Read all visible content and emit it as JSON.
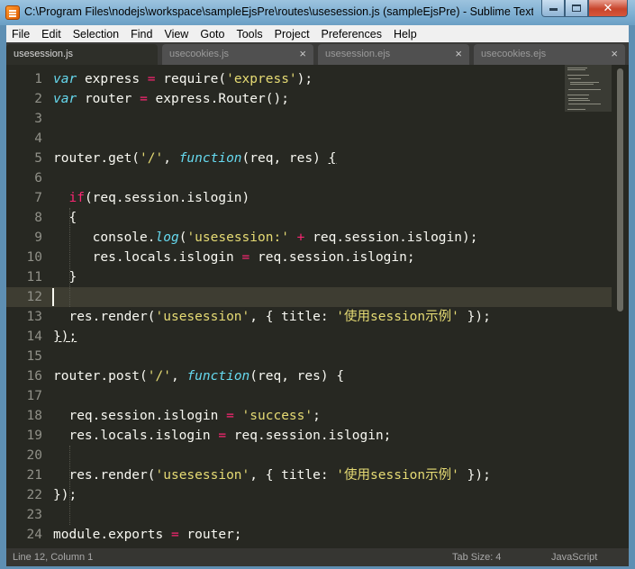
{
  "window": {
    "title": "C:\\Program Files\\nodejs\\workspace\\sampleEjsPre\\routes\\usesession.js (sampleEjsPre) - Sublime Text",
    "icon": "sublime-text-icon"
  },
  "menu": [
    "File",
    "Edit",
    "Selection",
    "Find",
    "View",
    "Goto",
    "Tools",
    "Project",
    "Preferences",
    "Help"
  ],
  "tabs": [
    {
      "label": "usesession.js",
      "active": true
    },
    {
      "label": "usecookies.js",
      "active": false
    },
    {
      "label": "usesession.ejs",
      "active": false
    },
    {
      "label": "usecookies.ejs",
      "active": false
    }
  ],
  "tab_close_glyph": "×",
  "line_numbers": [
    "1",
    "2",
    "3",
    "4",
    "5",
    "6",
    "7",
    "8",
    "9",
    "10",
    "11",
    "12",
    "13",
    "14",
    "15",
    "16",
    "17",
    "18",
    "19",
    "20",
    "21",
    "22",
    "23",
    "24"
  ],
  "code": {
    "kw_var": "var",
    "kw_function": "function",
    "kw_if": "if",
    "op_eq": "=",
    "op_plus": "+",
    "id_express": "express",
    "id_router": "router",
    "call_require": "require(",
    "str_express": "'express'",
    "close_paren_semi": ");",
    "call_express_router": "express.Router();",
    "call_router_get": "router.get(",
    "call_router_post": "router.post(",
    "str_root": "'/'",
    "comma_space": ", ",
    "params": "(req, res) ",
    "brace_open": "{",
    "brace_close": "}",
    "brace_close_end": "});",
    "cond": "(req.session.islogin)",
    "console_log": "console.",
    "log_fn": "log",
    "paren_open": "(",
    "str_usesession_colon": "'usesession:'",
    "req_islogin_end": " req.session.islogin);",
    "res_locals": "res.locals.islogin ",
    "req_islogin_semi": " req.session.islogin;",
    "res_render": "res.render(",
    "str_usesession": "'usesession'",
    "title_obj": ", { title: ",
    "str_title": "'使用session示例'",
    "obj_end": " });",
    "req_session_islogin": "req.session.islogin ",
    "str_success": "'success'",
    "semi": ";",
    "module_exports": "module.exports ",
    "router_semi": " router;"
  },
  "status": {
    "position": "Line 12, Column 1",
    "tab_size": "Tab Size: 4",
    "syntax": "JavaScript"
  },
  "theme": {
    "background": "#272822",
    "keyword": "#66d9ef",
    "operator": "#f92672",
    "string": "#e6db74",
    "text": "#f8f8f2"
  }
}
